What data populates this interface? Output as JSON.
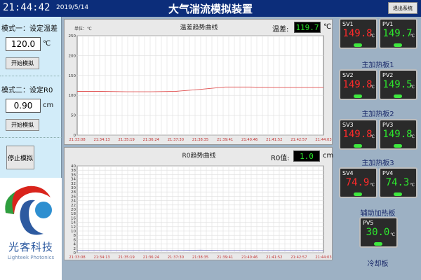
{
  "header": {
    "time": "21:44:42",
    "date": "2019/5/14",
    "title": "大气湍流模拟装置",
    "exit_label": "退出系统"
  },
  "left": {
    "mode1_label": "模式一：设定温差",
    "mode1_value": "120.0",
    "mode1_unit": "℃",
    "mode1_button": "开始模拟",
    "mode2_label": "模式二：设定R0",
    "mode2_value": "0.90",
    "mode2_unit": "cm",
    "mode2_button": "开始模拟",
    "stop_button": "停止模拟",
    "brand_cn": "光客科技",
    "brand_en": "Lighteek Photonics"
  },
  "chart1": {
    "title": "温差趋势曲线",
    "unit_label": "单位：℃",
    "readout_label": "温差:",
    "readout_value": "119.7",
    "readout_unit": "℃"
  },
  "chart2": {
    "title": "R0趋势曲线",
    "readout_label": "R0值:",
    "readout_value": "1.0",
    "readout_unit": "cm"
  },
  "meters": [
    {
      "sv_label": "SV1",
      "sv_value": "149.8",
      "pv_label": "PV1",
      "pv_value": "149.7",
      "group": "主加热板1"
    },
    {
      "sv_label": "SV2",
      "sv_value": "149.8",
      "pv_label": "PV2",
      "pv_value": "149.5",
      "group": "主加热板2"
    },
    {
      "sv_label": "SV3",
      "sv_value": "149.8",
      "pv_label": "PV3",
      "pv_value": "149.8",
      "group": "主加热板3"
    },
    {
      "sv_label": "SV4",
      "sv_value": "74.9",
      "pv_label": "PV4",
      "pv_value": "74.3",
      "group": "辅助加热板"
    }
  ],
  "cooling": {
    "pv_label": "PV5",
    "pv_value": "30.0",
    "group": "冷却板"
  },
  "meter_unit": "℃",
  "colors": {
    "header": "#0c2d7a",
    "sv": "#ff2a2a",
    "pv": "#2ee82e",
    "curve1": "#e05050",
    "curve2": "#7070c0"
  },
  "chart_data": [
    {
      "type": "line",
      "title": "温差趋势曲线",
      "ylabel": "单位：℃",
      "ylim": [
        0,
        250
      ],
      "yticks": [
        0,
        50,
        100,
        150,
        200,
        250
      ],
      "x": [
        "21:33:08",
        "21:34:13",
        "21:35:19",
        "21:36:24",
        "21:37:30",
        "21:38:35",
        "21:39:41",
        "21:40:46",
        "21:41:52",
        "21:42:57",
        "21:44:03"
      ],
      "series": [
        {
          "values": [
            110,
            110,
            109,
            109,
            110,
            115,
            121,
            121,
            120,
            120,
            120
          ]
        }
      ]
    },
    {
      "type": "line",
      "title": "R0趋势曲线",
      "ylim": [
        0,
        40
      ],
      "yticks": [
        0,
        2,
        4,
        6,
        8,
        10,
        12,
        14,
        16,
        18,
        20,
        22,
        24,
        26,
        28,
        30,
        32,
        34,
        36,
        38,
        40
      ],
      "x": [
        "21:33:08",
        "21:34:13",
        "21:35:19",
        "21:36:24",
        "21:37:30",
        "21:38:35",
        "21:39:41",
        "21:40:46",
        "21:41:52",
        "21:42:57",
        "21:44:03"
      ],
      "series": [
        {
          "values": [
            1,
            1,
            1,
            1,
            1,
            1.2,
            1,
            1,
            1,
            1,
            1
          ]
        }
      ]
    }
  ]
}
